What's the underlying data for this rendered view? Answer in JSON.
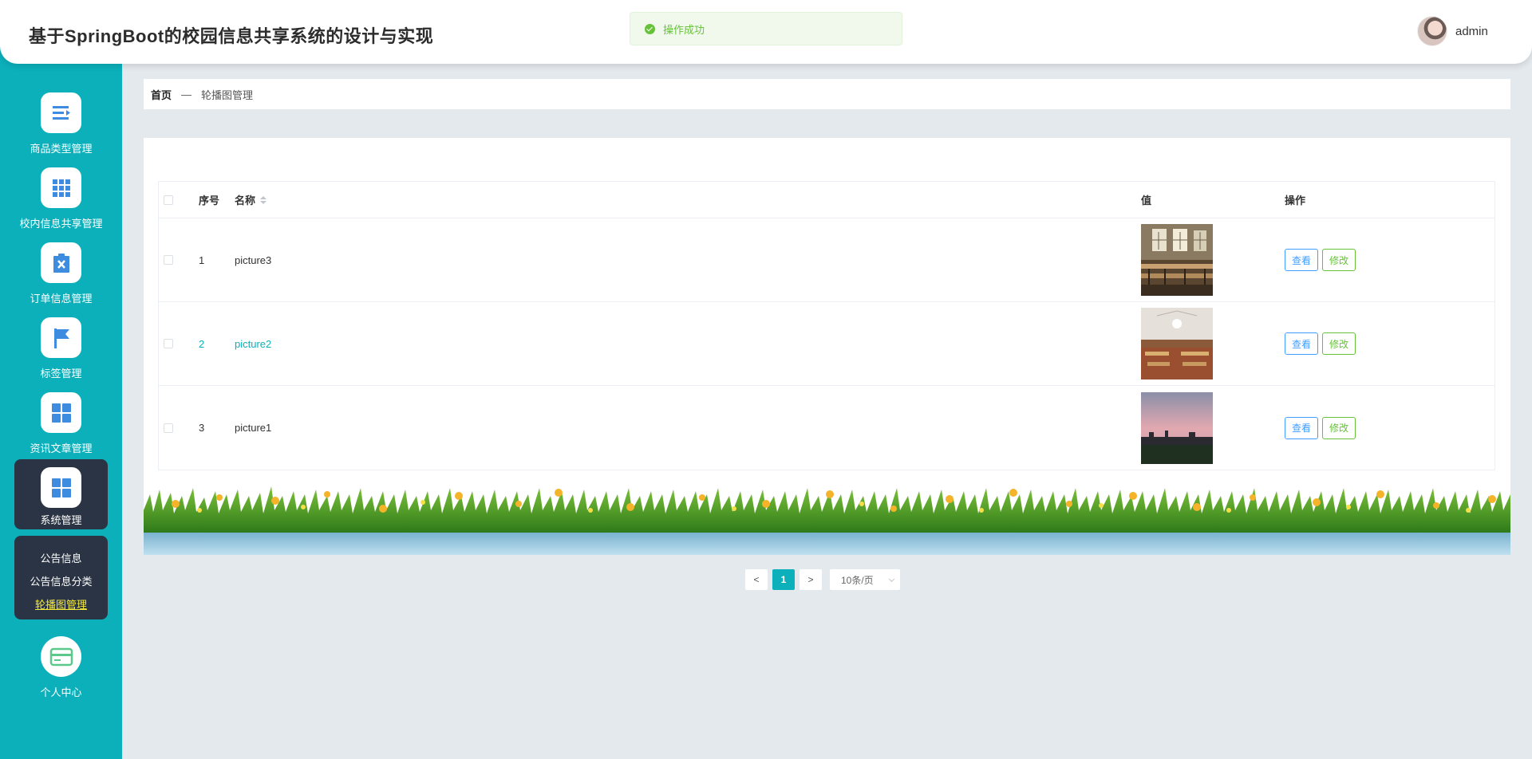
{
  "header": {
    "title": "基于SpringBoot的校园信息共享系统的设计与实现",
    "toast": "操作成功",
    "username": "admin"
  },
  "sidebar": {
    "items": [
      {
        "label": "商品类型管理",
        "icon": "list-icon"
      },
      {
        "label": "校内信息共享管理",
        "icon": "grid-icon"
      },
      {
        "label": "订单信息管理",
        "icon": "clipboard-x-icon"
      },
      {
        "label": "标签管理",
        "icon": "flag-icon"
      },
      {
        "label": "资讯文章管理",
        "icon": "apps-icon"
      },
      {
        "label": "系统管理",
        "icon": "apps-icon"
      },
      {
        "label": "个人中心",
        "icon": "card-icon"
      }
    ],
    "submenu": [
      "公告信息",
      "公告信息分类",
      "轮播图管理"
    ]
  },
  "breadcrumb": {
    "home": "首页",
    "separator": "—",
    "current": "轮播图管理"
  },
  "table": {
    "columns": {
      "index": "序号",
      "name": "名称",
      "value": "值",
      "actions": "操作"
    },
    "rows": [
      {
        "index": "1",
        "name": "picture3",
        "image": "library-interior"
      },
      {
        "index": "2",
        "name": "picture2",
        "image": "library-hall"
      },
      {
        "index": "3",
        "name": "picture1",
        "image": "sunset-campus"
      }
    ],
    "view_label": "查看",
    "edit_label": "修改"
  },
  "pagination": {
    "prev": "<",
    "current": "1",
    "next": ">",
    "page_size": "10条/页"
  },
  "colors": {
    "sidebar": "#0bb0bb",
    "sidebar_active": "#2b3444",
    "submenu_current": "#f5e93a",
    "view_button": "#409eff",
    "edit_button": "#67c23a"
  }
}
